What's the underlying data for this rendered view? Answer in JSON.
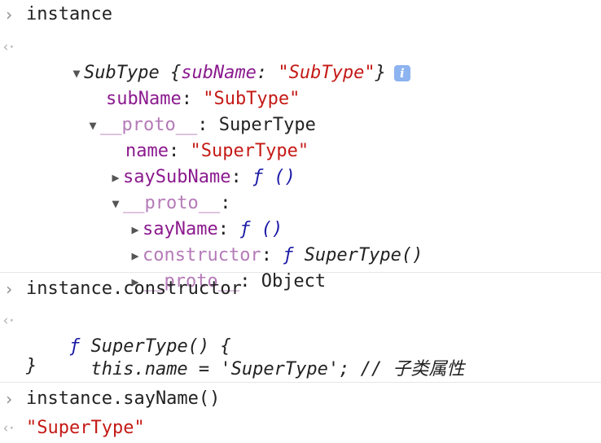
{
  "console": {
    "prompt_glyph": "›",
    "result_glyph": "‹·",
    "entry1": {
      "input": "instance",
      "summary_type": "SubType",
      "summary_open": " {",
      "summary_key": "subName",
      "summary_colon": ": ",
      "summary_value": "\"SubType\"",
      "summary_close": "}",
      "info_icon": "i",
      "rows": {
        "subName_key": "subName",
        "subName_value": "\"SubType\"",
        "proto1_key": "__proto__",
        "proto1_value": ": SuperType",
        "name_key": "name",
        "name_value": "\"SuperType\"",
        "saySubName_key": "saySubName",
        "saySubName_value": "ƒ ()",
        "proto2_key": "__proto__",
        "proto2_colon": ":",
        "sayName_key": "sayName",
        "sayName_value": "ƒ ()",
        "constructor_key": "constructor",
        "constructor_f": "ƒ",
        "constructor_value": " SuperType()",
        "proto3_key": "__proto__",
        "proto3_value": ": Object"
      }
    },
    "entry2": {
      "input": "instance.constructor",
      "line1_f": "ƒ",
      "line1_rest": " SuperType() {",
      "line2_code": "  this.name = 'SuperType'; // ",
      "line2_comment": "子类属性",
      "line3": "}"
    },
    "entry3": {
      "input": "instance.sayName()",
      "result": "\"SuperType\""
    }
  }
}
